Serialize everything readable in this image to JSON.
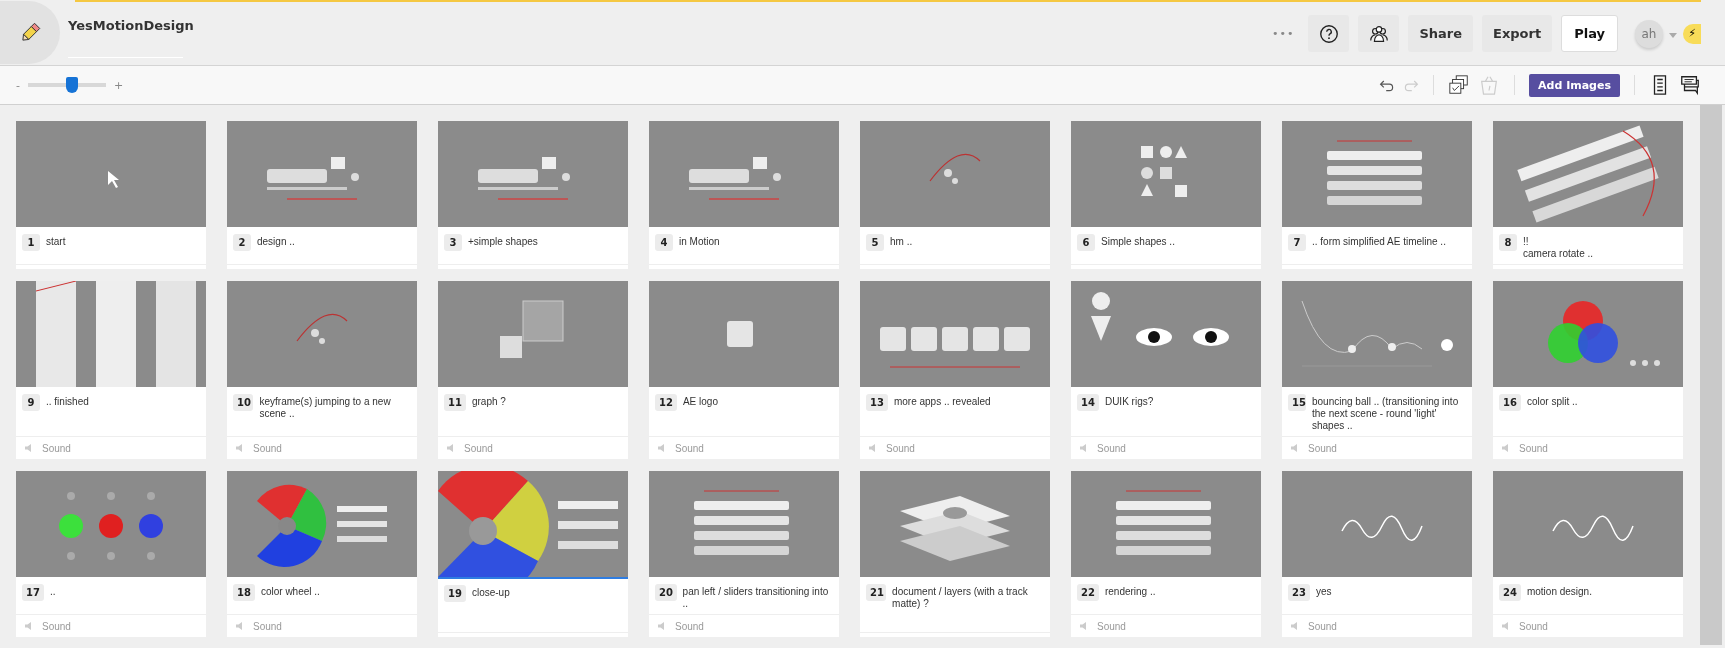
{
  "header": {
    "title": "YesMotionDesign",
    "more": "•••",
    "buttons": [
      {
        "kind": "help"
      },
      {
        "kind": "people"
      },
      {
        "kind": "text",
        "label": "Share"
      },
      {
        "kind": "text",
        "label": "Export"
      },
      {
        "kind": "play",
        "label": "Play"
      }
    ],
    "avatar": "ah",
    "badge": "⚡"
  },
  "toolbar": {
    "zoom": {
      "minus": "-",
      "plus": "+",
      "level": 0.56
    },
    "undo": {
      "disabled": false
    },
    "redo": {
      "disabled": true
    },
    "trash": {
      "disabled": true
    },
    "add_images": "Add Images"
  },
  "frames": [
    {
      "number": "1",
      "caption": "start",
      "selected": false
    },
    {
      "number": "2",
      "caption": "design ..",
      "selected": false
    },
    {
      "number": "3",
      "caption": "+simple  shapes",
      "selected": false
    },
    {
      "number": "4",
      "caption": "in Motion",
      "selected": false
    },
    {
      "number": "5",
      "caption": "hm ..",
      "selected": false
    },
    {
      "number": "6",
      "caption": "Simple shapes ..",
      "selected": false
    },
    {
      "number": "7",
      "caption": ".. form simplified AE timeline ..",
      "selected": false
    },
    {
      "number": "8",
      "caption": "!!\ncamera rotate ..",
      "selected": false
    },
    {
      "number": "9",
      "caption": ".. finished",
      "selected": false,
      "sound": "Sound"
    },
    {
      "number": "10",
      "caption": "keyframe(s) jumping to a new scene ..",
      "selected": false,
      "sound": "Sound"
    },
    {
      "number": "11",
      "caption": "graph ?",
      "selected": false,
      "sound": "Sound"
    },
    {
      "number": "12",
      "caption": "AE logo",
      "selected": false,
      "sound": "Sound"
    },
    {
      "number": "13",
      "caption": "more apps .. revealed",
      "selected": false,
      "sound": "Sound"
    },
    {
      "number": "14",
      "caption": "DUIK rigs?",
      "selected": false,
      "sound": "Sound"
    },
    {
      "number": "15",
      "caption": "bouncing ball .. (transitioning into the next scene - round 'light' shapes ..",
      "selected": false,
      "sound": "Sound"
    },
    {
      "number": "16",
      "caption": "color split ..",
      "selected": false,
      "sound": "Sound"
    },
    {
      "number": "17",
      "caption": "..",
      "selected": false,
      "sound": "Sound"
    },
    {
      "number": "18",
      "caption": "color wheel ..",
      "selected": false,
      "sound": "Sound"
    },
    {
      "number": "19",
      "caption": "close-up",
      "selected": true
    },
    {
      "number": "20",
      "caption": "pan left / sliders transitioning into ..",
      "selected": false,
      "sound": "Sound"
    },
    {
      "number": "21",
      "caption": "document / layers (with a track matte) ?",
      "selected": false
    },
    {
      "number": "22",
      "caption": "rendering ..",
      "selected": false,
      "sound": "Sound"
    },
    {
      "number": "23",
      "caption": "yes",
      "selected": false,
      "sound": "Sound"
    },
    {
      "number": "24",
      "caption": "motion design.",
      "selected": false,
      "sound": "Sound"
    }
  ]
}
